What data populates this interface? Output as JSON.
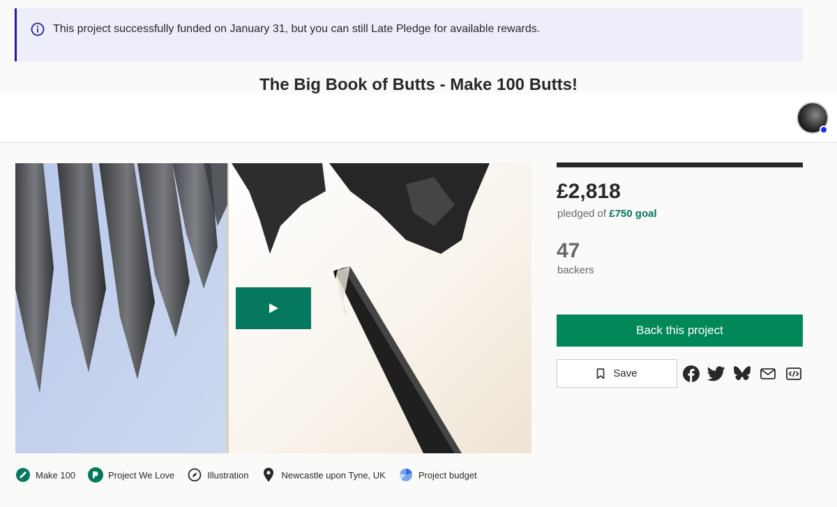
{
  "notice": {
    "icon": "info-icon",
    "text": "This project successfully funded on January 31, but you can still Late Pledge for available rewards."
  },
  "project": {
    "title": "The Big Book of Butts - Make 100 Butts!"
  },
  "header": {
    "avatar": "user-avatar",
    "online_status_color": "#1530e8"
  },
  "media": {
    "play_icon": "play-icon",
    "accent_color": "#05785f"
  },
  "stats": {
    "funded_fraction": 1.0,
    "pledged": "£2,818",
    "pledged_prefix": "pledged of",
    "goal": "£750 goal",
    "backers": "47",
    "backers_label": "backers"
  },
  "actions": {
    "back_label": "Back this project",
    "back_color": "#028858",
    "save_label": "Save",
    "share_icons": [
      "facebook-icon",
      "twitter-icon",
      "bluesky-icon",
      "email-icon",
      "embed-icon"
    ]
  },
  "tags": [
    {
      "icon": "make100-icon",
      "label": "Make 100"
    },
    {
      "icon": "project-we-love-icon",
      "label": "Project We Love"
    },
    {
      "icon": "compass-icon",
      "label": "Illustration"
    },
    {
      "icon": "location-pin-icon",
      "label": "Newcastle upon Tyne, UK"
    },
    {
      "icon": "project-budget-icon",
      "label": "Project budget"
    }
  ]
}
